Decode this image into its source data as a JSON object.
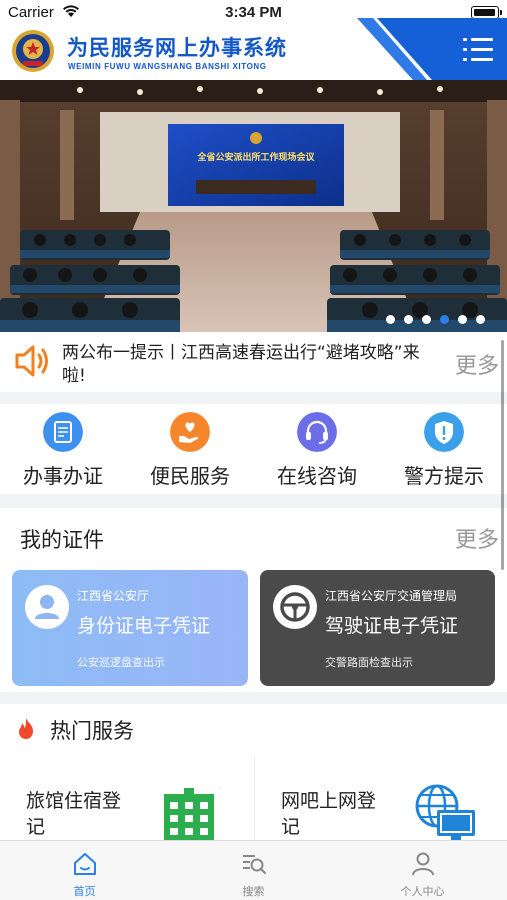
{
  "status_bar": {
    "carrier": "Carrier",
    "time": "3:34 PM"
  },
  "header": {
    "title": "为民服务网上办事系统",
    "subtitle": "WEIMIN FUWU WANGSHANG BANSHI XITONG"
  },
  "banner": {
    "screen_text": "全省公安派出所工作现场会议",
    "slide_count": 6,
    "active_slide": 4
  },
  "notice": {
    "text": "两公布一提示丨江西高速春运出行“避堵攻略”来啦!",
    "more_label": "更多"
  },
  "quick_actions": [
    {
      "label": "办事办证",
      "icon": "document-icon",
      "color": "#3d8ff0"
    },
    {
      "label": "便民服务",
      "icon": "heart-hand-icon",
      "color": "#f5862c"
    },
    {
      "label": "在线咨询",
      "icon": "headset-icon",
      "color": "#6c6ee8"
    },
    {
      "label": "警方提示",
      "icon": "shield-alert-icon",
      "color": "#3aa0ea"
    }
  ],
  "my_documents": {
    "title": "我的证件",
    "more_label": "更多",
    "cards": [
      {
        "org": "江西省公安厅",
        "name": "身份证电子凭证",
        "hint": "公安巡逻盘查出示",
        "icon": "person-icon"
      },
      {
        "org": "江西省公安厅交通管理局",
        "name": "驾驶证电子凭证",
        "hint": "交警路面检查出示",
        "icon": "steering-wheel-icon"
      }
    ]
  },
  "hot_services": {
    "title": "热门服务",
    "items": [
      {
        "name": "旅馆住宿登记",
        "icon": "hotel-icon"
      },
      {
        "name": "网吧上网登记",
        "icon": "internet-cafe-icon"
      }
    ]
  },
  "tabs": [
    {
      "label": "首页",
      "icon": "home-icon",
      "active": true
    },
    {
      "label": "搜索",
      "icon": "search-list-icon",
      "active": false
    },
    {
      "label": "个人中心",
      "icon": "user-icon",
      "active": false
    }
  ],
  "colors": {
    "brand_blue": "#1458c8",
    "accent": "#2b7fe8"
  }
}
